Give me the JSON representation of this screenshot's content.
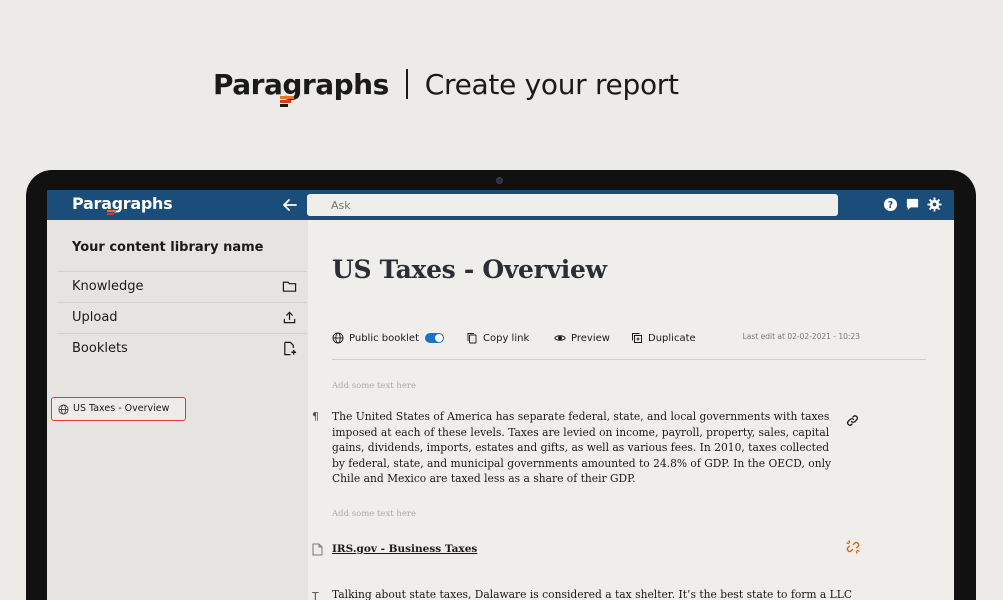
{
  "hero": {
    "brand": "Paragraphs",
    "tagline": "Create your report"
  },
  "colors": {
    "accent_blue": "#1a4d7a",
    "toggle_blue": "#1a73c7",
    "highlight_red": "#e53935",
    "brand_orange": "#e8742b",
    "brand_red": "#d8392b"
  },
  "topbar": {
    "brand": "Paragraphs",
    "ask_placeholder": "Ask",
    "icons": [
      "help-icon",
      "chat-icon",
      "settings-icon"
    ]
  },
  "sidebar": {
    "library_name": "Your content library name",
    "items": [
      {
        "label": "Knowledge",
        "icon": "folder-icon"
      },
      {
        "label": "Upload",
        "icon": "upload-icon"
      },
      {
        "label": "Booklets",
        "icon": "add-document-icon"
      }
    ],
    "booklets": [
      {
        "label": "US Taxes - Overview",
        "icon": "globe-icon",
        "selected": true
      }
    ]
  },
  "document": {
    "title": "US Taxes - Overview",
    "toolbar": {
      "public_booklet": "Public booklet",
      "public_booklet_on": true,
      "copy_link": "Copy link",
      "preview": "Preview",
      "duplicate": "Duplicate",
      "last_edit": "Last edit at 02-02-2021 - 10:23"
    },
    "placeholder_1": "Add some text here",
    "paragraph_1": "The United States of America has separate federal, state, and local governments with taxes imposed at each of these levels. Taxes are levied on income, payroll, property, sales, capital gains, dividends, imports, estates and gifts, as well as various fees. In 2010, taxes collected by federal, state, and municipal governments amounted to 24.8% of GDP. In the OECD, only Chile and Mexico are taxed less as a share of their GDP.",
    "placeholder_2": "Add some text here",
    "source_link": "IRS.gov - Business Taxes",
    "paragraph_2": "Talking about state taxes, Dalaware is considered a tax shelter. It’s the best state to form a LLC: it"
  }
}
